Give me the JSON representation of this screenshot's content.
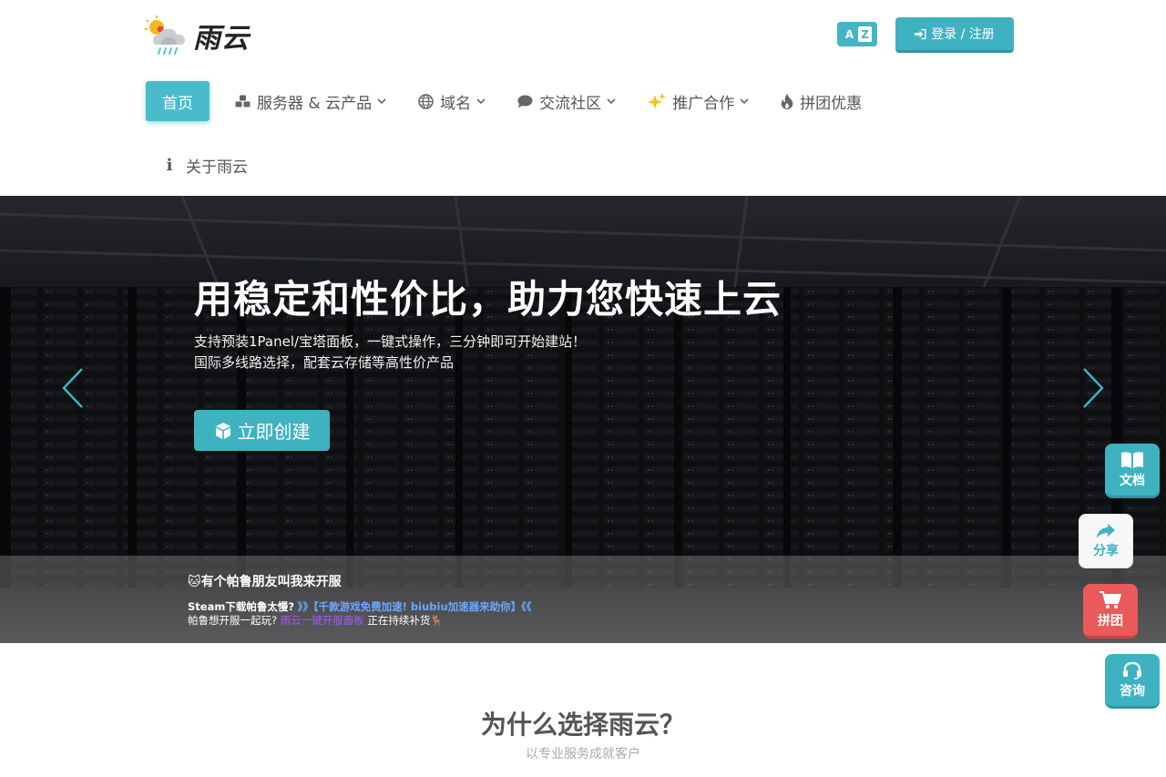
{
  "brand": {
    "name": "雨云"
  },
  "header": {
    "login_label": "登录 / 注册",
    "lang_a": "A",
    "lang_z": "Z"
  },
  "nav": {
    "home": "首页",
    "servers": "服务器 & 云产品",
    "domain": "域名",
    "community": "交流社区",
    "promote": "推广合作",
    "groupbuy": "拼团优惠",
    "about": "关于雨云"
  },
  "hero": {
    "title": "用稳定和性价比，助力您快速上云",
    "sub1": "支持预装1Panel/宝塔面板，一键式操作，三分钟即可开始建站！",
    "sub2": "国际多线路选择，配套云存储等高性价产品",
    "cta": "立即创建"
  },
  "ticker": {
    "title": "🐱有个帕鲁朋友叫我来开服",
    "l1_prefix": "Steam下载帕鲁太慢?",
    "l1_link": "》》【千款游戏免费加速! biubiu加速器来助你】《《",
    "l2_prefix": "帕鲁想开服一起玩?",
    "l2_link": "雨云一键开服面板",
    "l2_suffix": "正在持续补货🦌"
  },
  "floating": {
    "docs": "文档",
    "share": "分享",
    "group": "拼团",
    "consult": "咨询"
  },
  "why": {
    "title": "为什么选择雨云？",
    "sub": "以专业服务成就客户"
  },
  "colors": {
    "accent": "#3fb2c1",
    "danger": "#ea5a5a",
    "link_blue": "#69a9ff",
    "link_purple": "#a35bf5"
  }
}
